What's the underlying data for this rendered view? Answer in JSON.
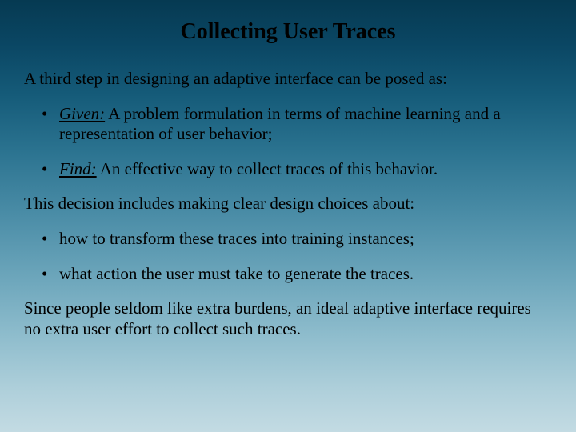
{
  "title": "Collecting User Traces",
  "intro": "A third step in designing an adaptive interface can be posed as:",
  "bullets1": [
    {
      "lead": "Given:",
      "rest": " A problem formulation in terms of machine learning and a representation of user behavior;"
    },
    {
      "lead": "Find:",
      "rest": " An effective way to collect traces of this behavior."
    }
  ],
  "middle": "This decision includes making clear design choices about:",
  "bullets2": [
    "how to transform these traces into training instances;",
    "what action the user must take to generate the traces."
  ],
  "closing": "Since people seldom like extra burdens, an ideal adaptive interface requires no extra user effort to collect such traces."
}
